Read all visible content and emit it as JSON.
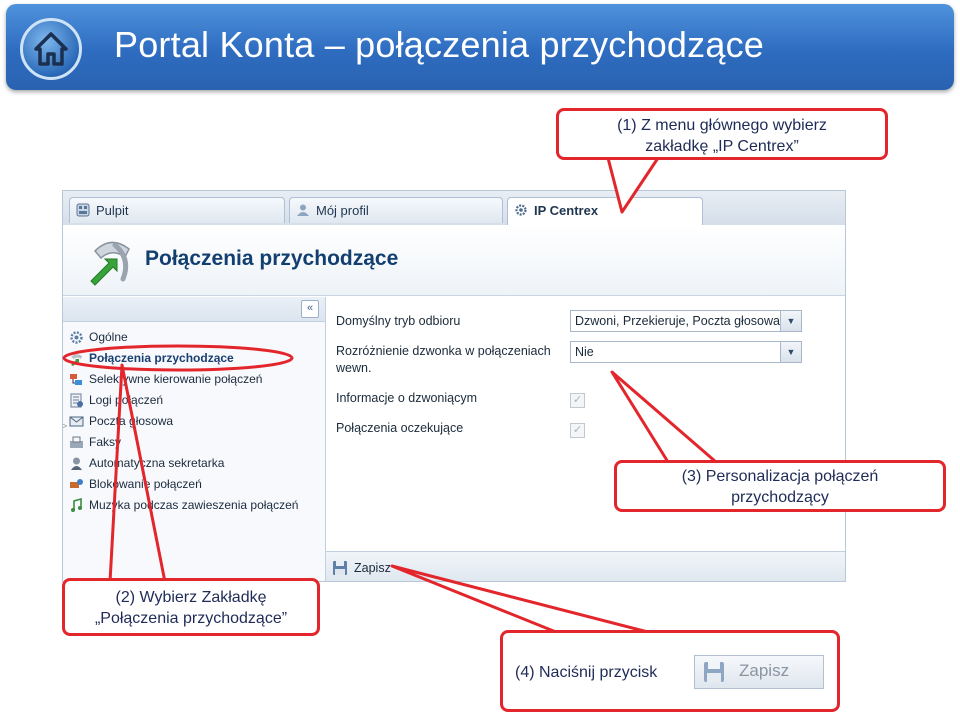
{
  "slide": {
    "title": "Portal Konta – połączenia przychodzące",
    "home_icon": "home-icon"
  },
  "app": {
    "tabs": [
      {
        "label": "Pulpit",
        "icon": "dashboard-icon"
      },
      {
        "label": "Mój profil",
        "icon": "user-icon"
      },
      {
        "label": "IP Centrex",
        "icon": "gear-icon",
        "active": true
      }
    ],
    "page_title": "Połączenia przychodzące",
    "collapse_symbol": "«",
    "nav": [
      {
        "label": "Ogólne",
        "icon": "gear-icon"
      },
      {
        "label": "Połączenia przychodzące",
        "icon": "incoming-call-icon",
        "selected": true
      },
      {
        "label": "Selektywne kierowanie połączeń",
        "icon": "routing-icon"
      },
      {
        "label": "Logi połączeń",
        "icon": "log-icon"
      },
      {
        "label": "Poczta głosowa",
        "icon": "voicemail-icon",
        "expandable": true
      },
      {
        "label": "Faksy",
        "icon": "fax-icon"
      },
      {
        "label": "Automatyczna sekretarka",
        "icon": "auto-attendant-icon"
      },
      {
        "label": "Blokowanie połączeń",
        "icon": "block-icon"
      },
      {
        "label": "Muzyka podczas zawieszenia połączeń",
        "icon": "music-icon"
      }
    ],
    "form": {
      "answer_mode_label": "Domyślny tryb odbioru",
      "answer_mode_value": "Dzwoni, Przekieruje, Poczta głosowa",
      "distinctive_ring_label_1": "Rozróżnienie dzwonka w połączeniach",
      "distinctive_ring_label_2": "wewn.",
      "distinctive_ring_value": "Nie",
      "caller_info_label": "Informacje o dzwoniącym",
      "caller_info_checked": true,
      "call_waiting_label": "Połączenia oczekujące",
      "call_waiting_checked": true
    },
    "save_label": "Zapisz"
  },
  "callouts": {
    "c1_line1": "(1) Z menu głównego wybierz",
    "c1_line2": "zakładkę „IP Centrex”",
    "c2_line1": "(2) Wybierz Zakładkę",
    "c2_line2": "„Połączenia przychodzące”",
    "c3_line1": "(3) Personalizacja  połączeń",
    "c3_line2": "przychodzący",
    "c4_text": "(4) Naciśnij przycisk",
    "c4_button_label": "Zapisz"
  },
  "colors": {
    "banner": "#2e6cc0",
    "callout_border": "#e3262b",
    "callout_text": "#1f2b57",
    "page_title": "#123f70"
  }
}
